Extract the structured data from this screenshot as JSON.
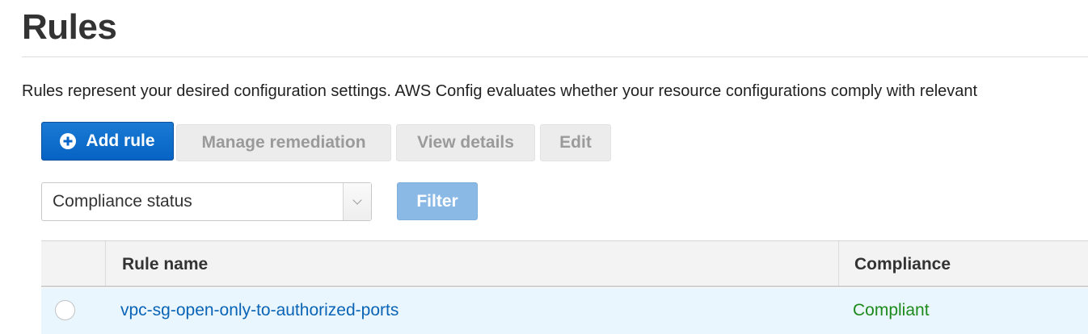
{
  "page": {
    "title": "Rules",
    "description": "Rules represent your desired configuration settings. AWS Config evaluates whether your resource configurations comply with relevant"
  },
  "toolbar": {
    "add_rule_label": "Add rule",
    "manage_remediation_label": "Manage remediation",
    "view_details_label": "View details",
    "edit_label": "Edit"
  },
  "filter": {
    "select_value": "Compliance status",
    "filter_button_label": "Filter"
  },
  "table": {
    "columns": [
      "",
      "Rule name",
      "Compliance"
    ],
    "rows": [
      {
        "selected": false,
        "rule_name": "vpc-sg-open-only-to-authorized-ports",
        "compliance": "Compliant"
      }
    ]
  },
  "colors": {
    "primary_button": "#0663c4",
    "link": "#0a64b6",
    "compliant": "#1d8a1d",
    "row_highlight": "#eaf6fd",
    "filter_button": "#8bb9e6"
  },
  "icons": {
    "add": "plus-circle-icon",
    "dropdown": "chevron-down-icon"
  }
}
